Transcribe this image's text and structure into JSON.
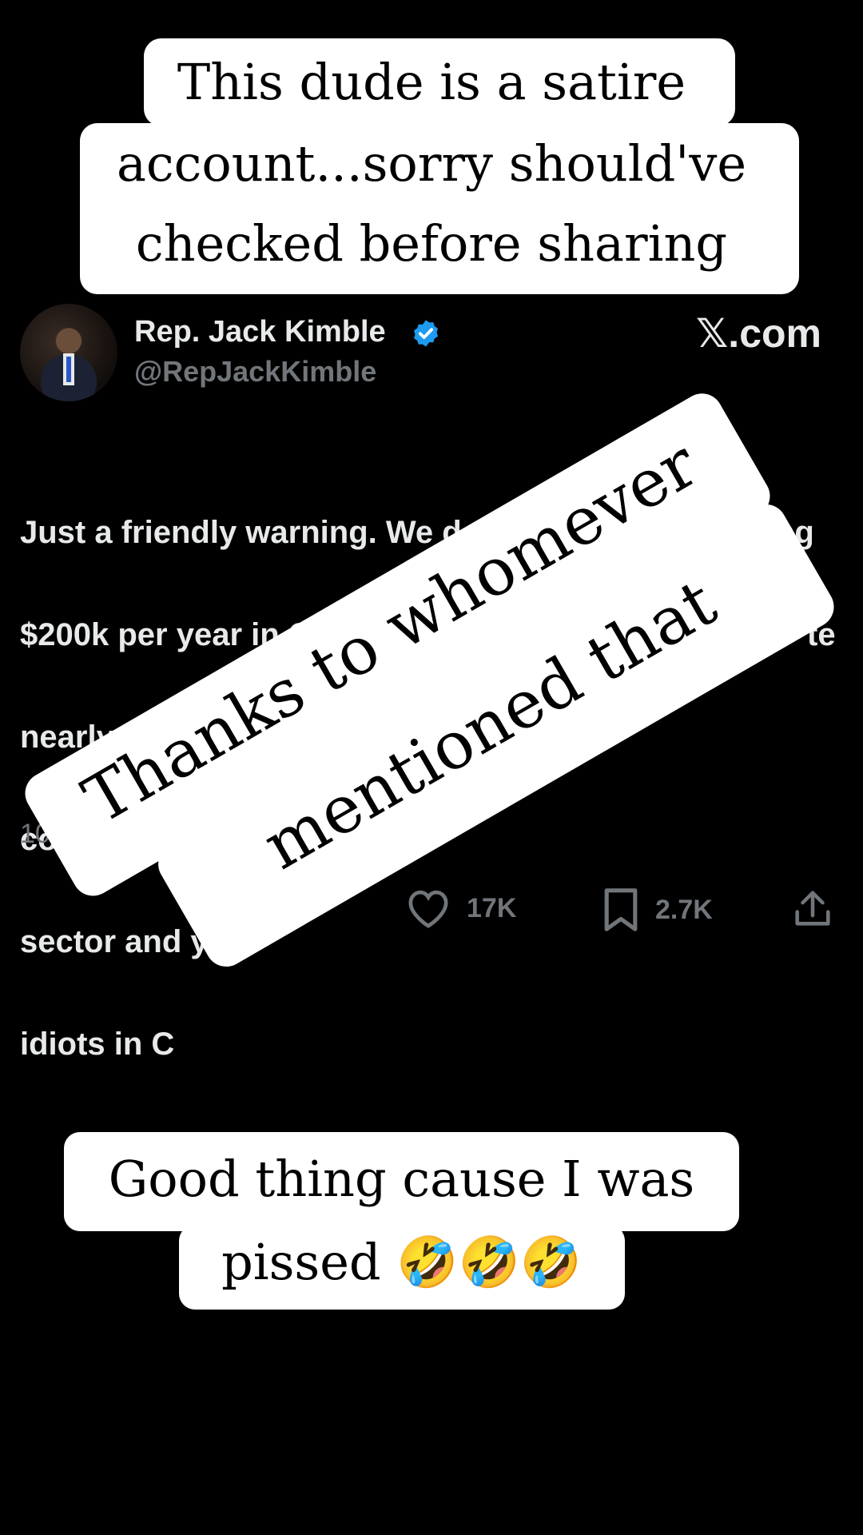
{
  "tweet": {
    "display_name": "Rep. Jack Kimble",
    "handle": "@RepJackKimble",
    "site_label": "com",
    "body_lines": [
      "Just a friendly warning. We don't",
      "$200k per year in Congress",
      "nearly 140 days.  If we",
      "compensated, a lot",
      "sector and you",
      "idiots in C"
    ],
    "body_fragments": [
      "ng",
      "te",
      "..."
    ],
    "timestamp": "10",
    "likes": "17K",
    "bookmarks": "2.7K"
  },
  "captions": {
    "top_line_1": "This dude is a satire",
    "top_line_2": "account...sorry should've",
    "top_line_3": "checked before sharing",
    "rotated_line_1": "Thanks to whomever",
    "rotated_line_2": "mentioned that",
    "bottom_line_1": "Good thing cause I was",
    "bottom_line_2": "pissed 🤣🤣🤣"
  },
  "colors": {
    "background": "#000000",
    "text_primary": "#e7e9ea",
    "text_secondary": "#71767b",
    "verified": "#1d9bf0",
    "caption_bg": "#ffffff"
  }
}
